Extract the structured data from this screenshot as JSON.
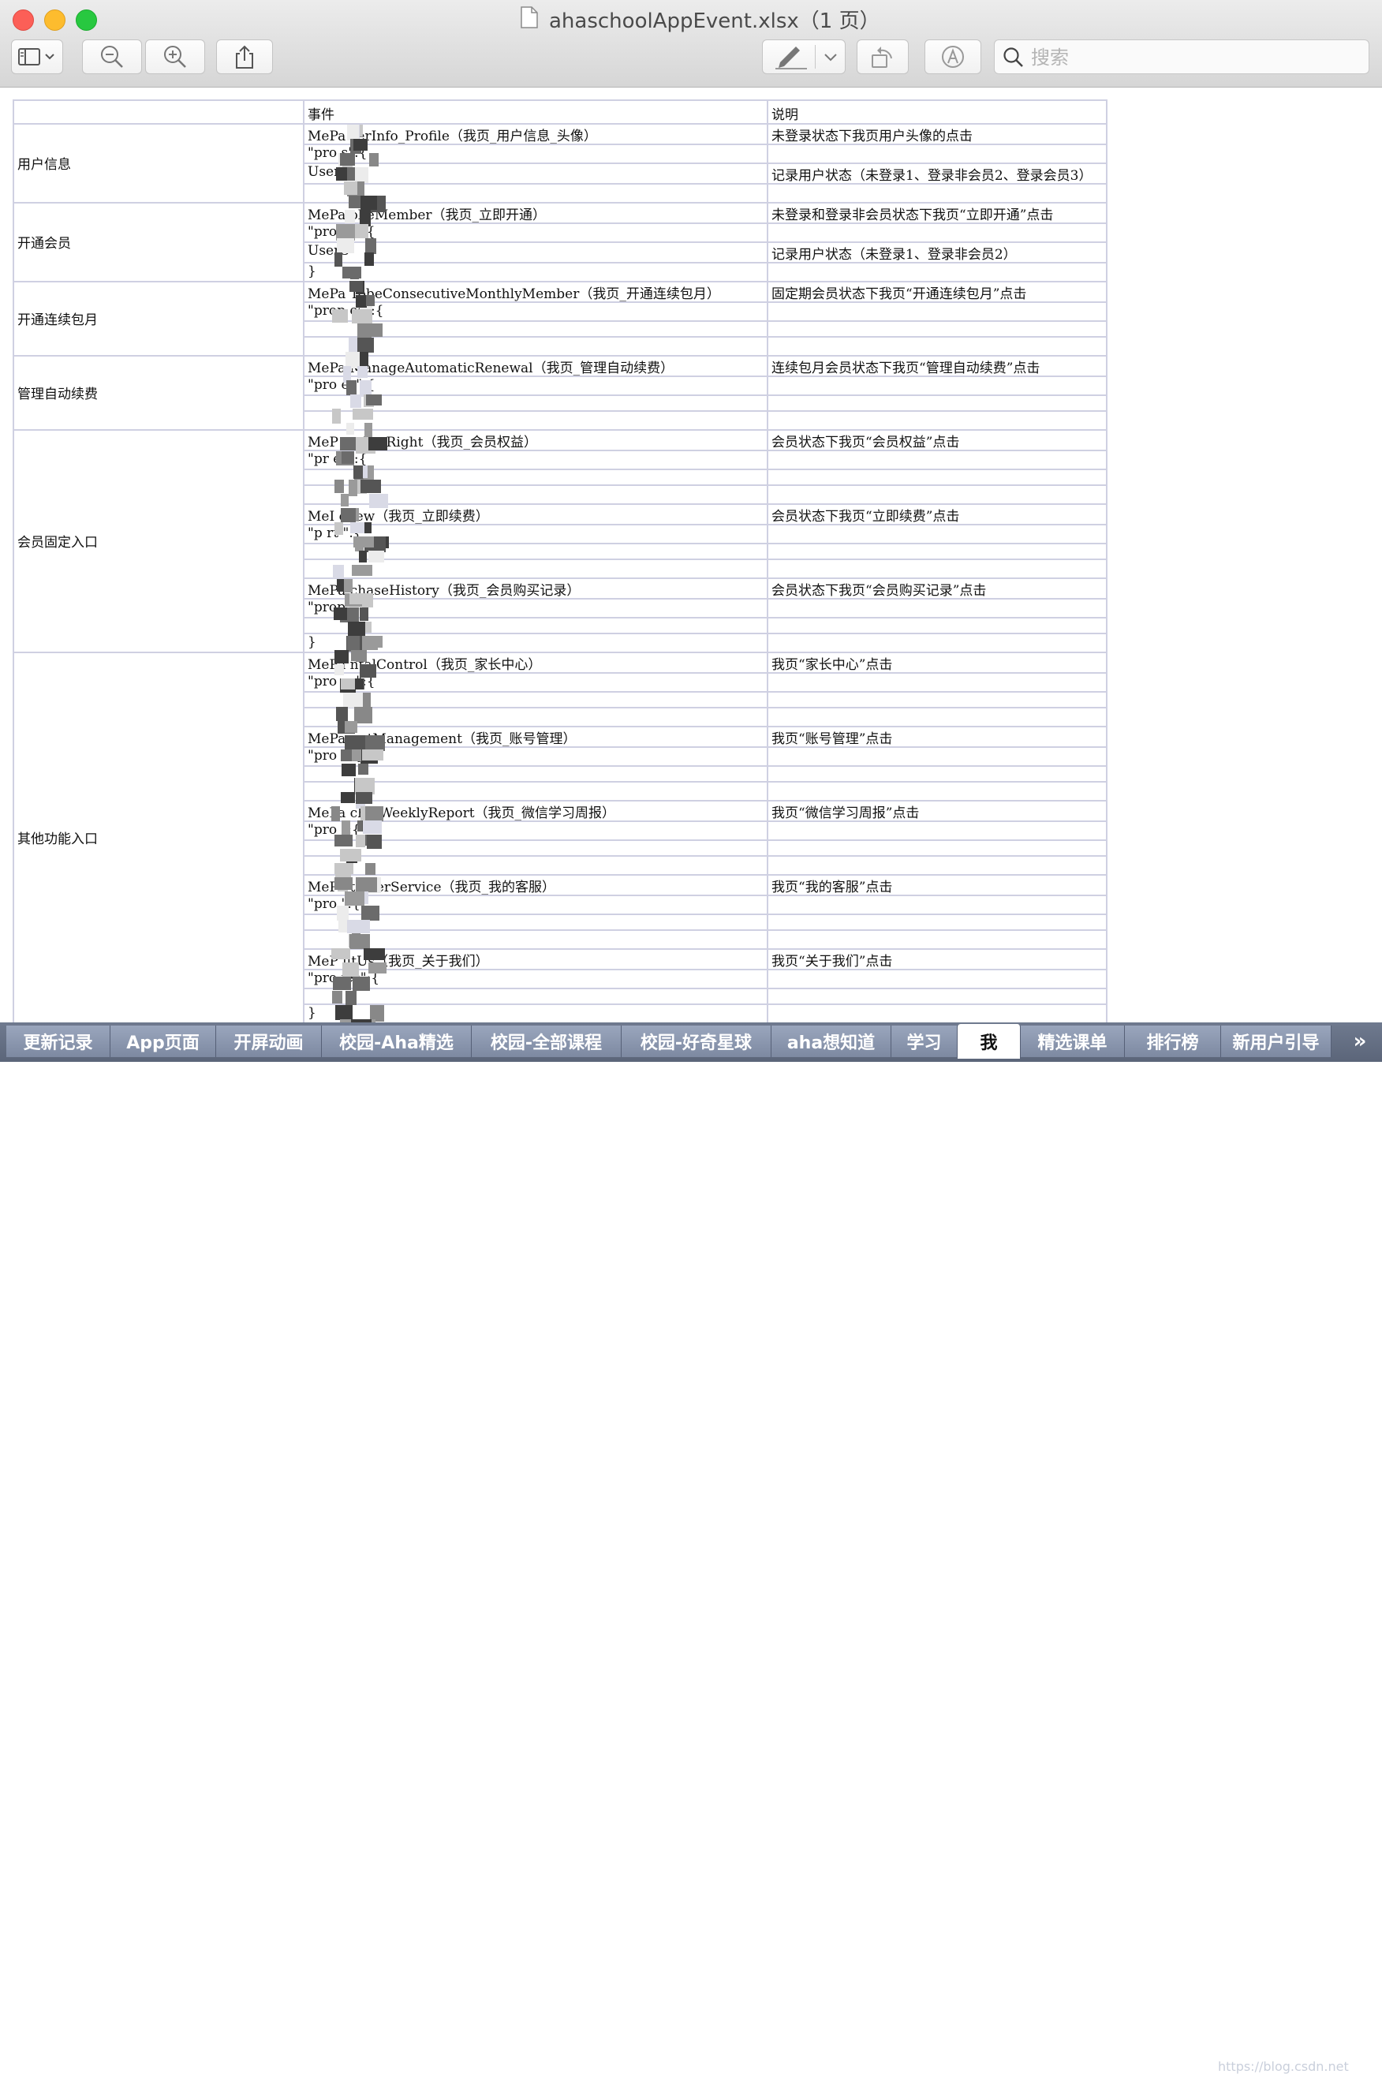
{
  "window": {
    "title": "ahaschoolAppEvent.xlsx（1 页）"
  },
  "toolbar": {
    "sidebar_icon": "sidebar-icon",
    "zoom_out_icon": "zoom-out-icon",
    "zoom_in_icon": "zoom-in-icon",
    "share_icon": "share-icon",
    "markup_icon": "pen-icon",
    "rotate_icon": "rotate-icon",
    "annotate_icon": "annotate-icon",
    "search_placeholder": "搜索"
  },
  "sheet": {
    "header": {
      "col_a": "",
      "col_b": "事件",
      "col_c": "说明"
    },
    "sections": [
      {
        "name": "用户信息"
      },
      {
        "name": "开通会员"
      },
      {
        "name": "开通连续包月"
      },
      {
        "name": "管理自动续费"
      },
      {
        "name": "会员固定入口"
      },
      {
        "name": "其他功能入口"
      }
    ],
    "rows": [
      {
        "event": "MePa  serInfo_Profile（我页_用户信息_头像）",
        "desc": "未登录状态下我页用户头像的点击"
      },
      {
        "event": "\"pro     s\":{",
        "desc": ""
      },
      {
        "event": "UserS",
        "desc": "记录用户状态（未登录1、登录非会员2、登录会员3）"
      },
      {
        "event": "",
        "desc": ""
      },
      {
        "event": "MePa  obeMember（我页_立即开通）",
        "desc": "未登录和登录非会员状态下我页“立即开通”点击"
      },
      {
        "event": "\"pro     es\":{",
        "desc": ""
      },
      {
        "event": "UserS",
        "desc": "记录用户状态（未登录1、登录非会员2）"
      },
      {
        "event": "}",
        "desc": ""
      },
      {
        "event": "MePa  TobeConsecutiveMonthlyMember（我页_开通连续包月）",
        "desc": "固定期会员状态下我页“开通连续包月”点击"
      },
      {
        "event": "\"prop   es\":{",
        "desc": ""
      },
      {
        "event": "",
        "desc": ""
      },
      {
        "event": "",
        "desc": ""
      },
      {
        "event": "MePa  ManageAutomaticRenewal（我页_管理自动续费）",
        "desc": "连续包月会员状态下我页“管理自动续费”点击"
      },
      {
        "event": "\"pro     es\":{",
        "desc": ""
      },
      {
        "event": "",
        "desc": ""
      },
      {
        "event": "",
        "desc": ""
      },
      {
        "event": "MeP     emberRight（我页_会员权益）",
        "desc": "会员状态下我页“会员权益”点击"
      },
      {
        "event": "\"pr      es\":{",
        "desc": ""
      },
      {
        "event": "",
        "desc": ""
      },
      {
        "event": "",
        "desc": ""
      },
      {
        "event": "MeI     enew（我页_立即续费）",
        "desc": "会员状态下我页“立即续费”点击"
      },
      {
        "event": "\"p     rt   \":{",
        "desc": ""
      },
      {
        "event": "",
        "desc": ""
      },
      {
        "event": "",
        "desc": ""
      },
      {
        "event": "MePa     chaseHistory（我页_会员购买记录）",
        "desc": "会员状态下我页“会员购买记录”点击"
      },
      {
        "event": "\"prop     \":{",
        "desc": ""
      },
      {
        "event": "",
        "desc": ""
      },
      {
        "event": "}",
        "desc": ""
      },
      {
        "event": "MePa    ntalControl（我页_家长中心）",
        "desc": "我页“家长中心”点击"
      },
      {
        "event": "\"pro    es\":{",
        "desc": ""
      },
      {
        "event": "",
        "desc": ""
      },
      {
        "event": "",
        "desc": ""
      },
      {
        "event": "MePa     untManagement（我页_账号管理）",
        "desc": "我页“账号管理”点击"
      },
      {
        "event": "\"pro    e   {",
        "desc": ""
      },
      {
        "event": "",
        "desc": ""
      },
      {
        "event": "",
        "desc": ""
      },
      {
        "event": "MePa     chetWeeklyReport（我页_微信学习周报）",
        "desc": "我页“微信学习周报”点击"
      },
      {
        "event": "\"pro        \":{",
        "desc": ""
      },
      {
        "event": "",
        "desc": ""
      },
      {
        "event": "",
        "desc": ""
      },
      {
        "event": "MePa     tomerService（我页_我的客服）",
        "desc": "我页“我的客服”点击"
      },
      {
        "event": "\"pro        \":{",
        "desc": ""
      },
      {
        "event": "",
        "desc": ""
      },
      {
        "event": "",
        "desc": ""
      },
      {
        "event": "MeP      utUs（我页_关于我们）",
        "desc": "我页“关于我们”点击"
      },
      {
        "event": "\"pro   ies\":{",
        "desc": ""
      },
      {
        "event": "",
        "desc": ""
      },
      {
        "event": "}",
        "desc": ""
      }
    ]
  },
  "tabs": [
    {
      "label": "更新记录"
    },
    {
      "label": "App页面"
    },
    {
      "label": "开屏动画"
    },
    {
      "label": "校园-Aha精选"
    },
    {
      "label": "校园-全部课程"
    },
    {
      "label": "校园-好奇星球"
    },
    {
      "label": "aha想知道"
    },
    {
      "label": "学习"
    },
    {
      "label": "我",
      "active": true
    },
    {
      "label": "精选课单"
    },
    {
      "label": "排行榜"
    },
    {
      "label": "新用户引导"
    }
  ],
  "more_tabs_label": "»",
  "watermark": "https://blog.csdn.net",
  "colors": {
    "grid": "#cfd0e2",
    "tab_bg": "#7d89a1",
    "active_tab": "#ffffff"
  }
}
